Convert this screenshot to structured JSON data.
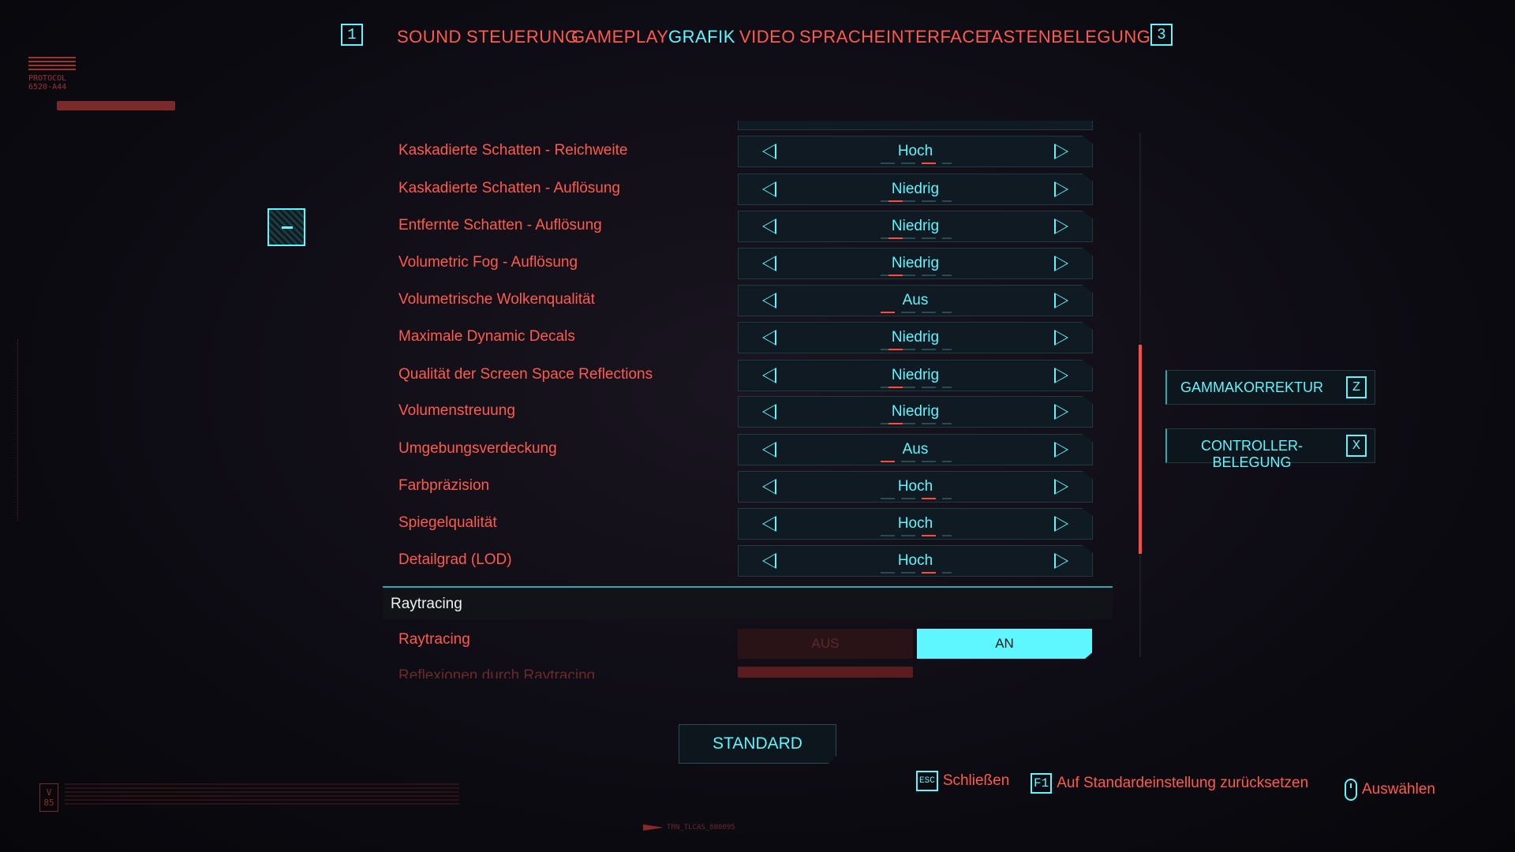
{
  "tabs": {
    "prev_key": "1",
    "next_key": "3",
    "items": [
      "SOUND",
      "STEUERUNG",
      "GAMEPLAY",
      "GRAFIK",
      "VIDEO",
      "SPRACHE",
      "INTERFACE",
      "TASTENBELEGUNG"
    ],
    "active": "GRAFIK"
  },
  "deco": {
    "protocol_line1": "PROTOCOL",
    "protocol_line2": "6520-A44",
    "v_badge": "V 85",
    "footer_code": "TRN_TLCAS_800095"
  },
  "settings": [
    {
      "label": "Kaskadierte Schatten - Reichweite",
      "value": "Hoch"
    },
    {
      "label": "Kaskadierte Schatten - Auflösung",
      "value": "Niedrig"
    },
    {
      "label": "Entfernte Schatten - Auflösung",
      "value": "Niedrig"
    },
    {
      "label": "Volumetric Fog - Auflösung",
      "value": "Niedrig"
    },
    {
      "label": "Volumetrische Wolkenqualität",
      "value": "Aus"
    },
    {
      "label": "Maximale Dynamic Decals",
      "value": "Niedrig"
    },
    {
      "label": "Qualität der Screen Space Reflections",
      "value": "Niedrig"
    },
    {
      "label": "Volumenstreuung",
      "value": "Niedrig"
    },
    {
      "label": "Umgebungsverdeckung",
      "value": "Aus"
    },
    {
      "label": "Farbpräzision",
      "value": "Hoch"
    },
    {
      "label": "Spiegelqualität",
      "value": "Hoch"
    },
    {
      "label": "Detailgrad (LOD)",
      "value": "Hoch"
    }
  ],
  "raytracing": {
    "section_title": "Raytracing",
    "row_label": "Raytracing",
    "off_label": "AUS",
    "on_label": "AN",
    "next_label": "Reflexionen durch Raytracing"
  },
  "side_buttons": [
    {
      "label": "GAMMAKORREKTUR",
      "key": "Z"
    },
    {
      "label": "CONTROLLER-BELEGUNG",
      "key": "X"
    }
  ],
  "bottom": {
    "standard_label": "STANDARD",
    "hints": [
      {
        "key": "ESC",
        "label": "Schließen"
      },
      {
        "key": "F1",
        "label": "Auf Standardeinstellung zurücksetzen"
      },
      {
        "key": "mouse-icon",
        "label": "Auswählen"
      }
    ]
  },
  "colors": {
    "accent_cyan": "#5ef6ff",
    "label_red": "#ff5a4e",
    "background": "#0e0c14"
  }
}
